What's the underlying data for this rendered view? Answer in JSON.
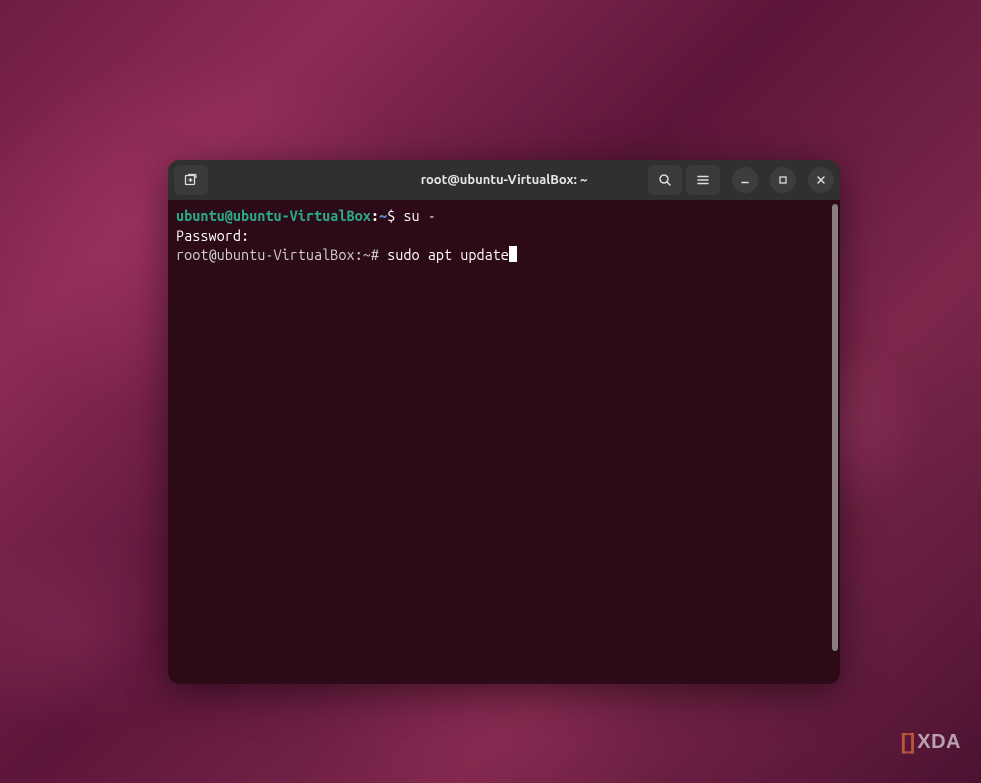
{
  "window": {
    "title": "root@ubuntu-VirtualBox: ~"
  },
  "terminal": {
    "line1": {
      "user_host": "ubuntu@ubuntu-VirtualBox",
      "colon": ":",
      "path": "~",
      "symbol": "$ ",
      "command": "su -"
    },
    "line2": {
      "text": "Password: "
    },
    "line3": {
      "prompt": "root@ubuntu-VirtualBox:~# ",
      "command": "sudo apt update"
    }
  },
  "watermark": {
    "bracket": "[]",
    "text": "XDA"
  },
  "icons": {
    "new_tab": "new-tab-icon",
    "search": "search-icon",
    "menu": "hamburger-icon",
    "minimize": "minimize-icon",
    "maximize": "maximize-icon",
    "close": "close-icon"
  }
}
